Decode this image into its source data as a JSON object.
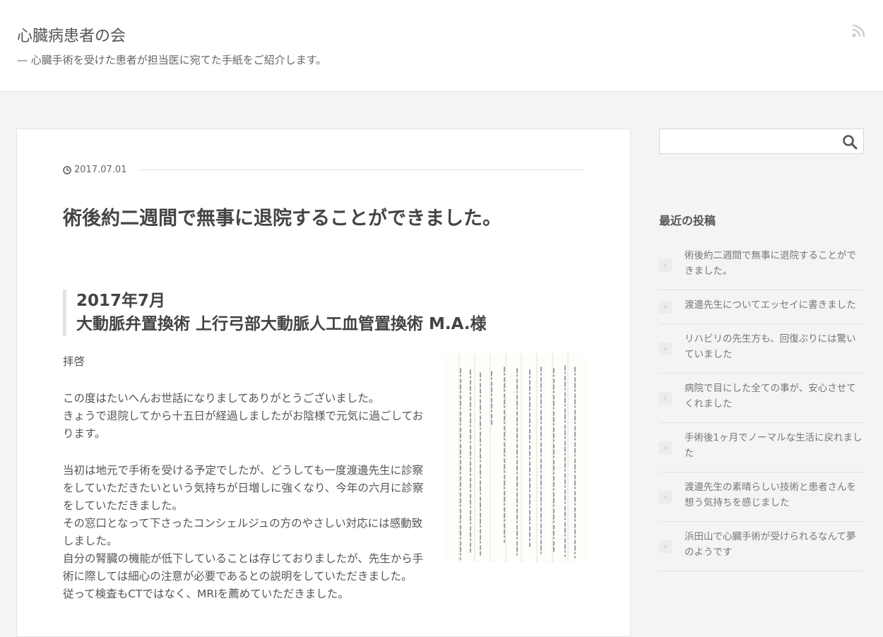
{
  "header": {
    "site_title": "心臓病患者の会",
    "site_description": "— 心臓手術を受けた患者が担当医に宛てた手紙をご紹介します。",
    "rss_icon": "rss-icon"
  },
  "article": {
    "date": "2017.07.01",
    "title": "術後約二週間で無事に退院することができました。",
    "blockquote": {
      "line1": "2017年7月",
      "line2": "大動脈弁置換術 上行弓部大動脈人工血管置換術 M.A.様"
    },
    "body": {
      "p1": "拝啓",
      "p2": "この度はたいへんお世話になりましてありがとうございました。",
      "p3": "きょうで退院してから十五日が経過しましたがお陰様で元気に過ごしております。",
      "p4": "当初は地元で手術を受ける予定でしたが、どうしても一度渡邊先生に診察をしていただきたいという気持ちが日増しに強くなり、今年の六月に診察をしていただきました。",
      "p5": "その窓口となって下さったコンシェルジュの方のやさしい対応には感動致しました。",
      "p6": "自分の腎臓の機能が低下していることは存じておりましたが、先生から手術に際しては細心の注意が必要であるとの説明をしていただきました。",
      "p7": "従って検査もCTではなく、MRIを薦めていただきました。"
    }
  },
  "sidebar": {
    "search_placeholder": "",
    "recent_title": "最近の投稿",
    "recent_posts": [
      "術後約二週間で無事に退院することができました。",
      "渡邊先生についてエッセイに書きました",
      "リハビリの先生方も、回復ぶりには驚いていました",
      "病院で目にした全ての事が、安心させてくれました",
      "手術後1ヶ月でノーマルな生活に戻れました",
      "渡邊先生の素晴らしい技術と患者さんを想う気持ちを感じました",
      "浜田山で心臓手術が受けられるなんて夢のようです"
    ]
  }
}
